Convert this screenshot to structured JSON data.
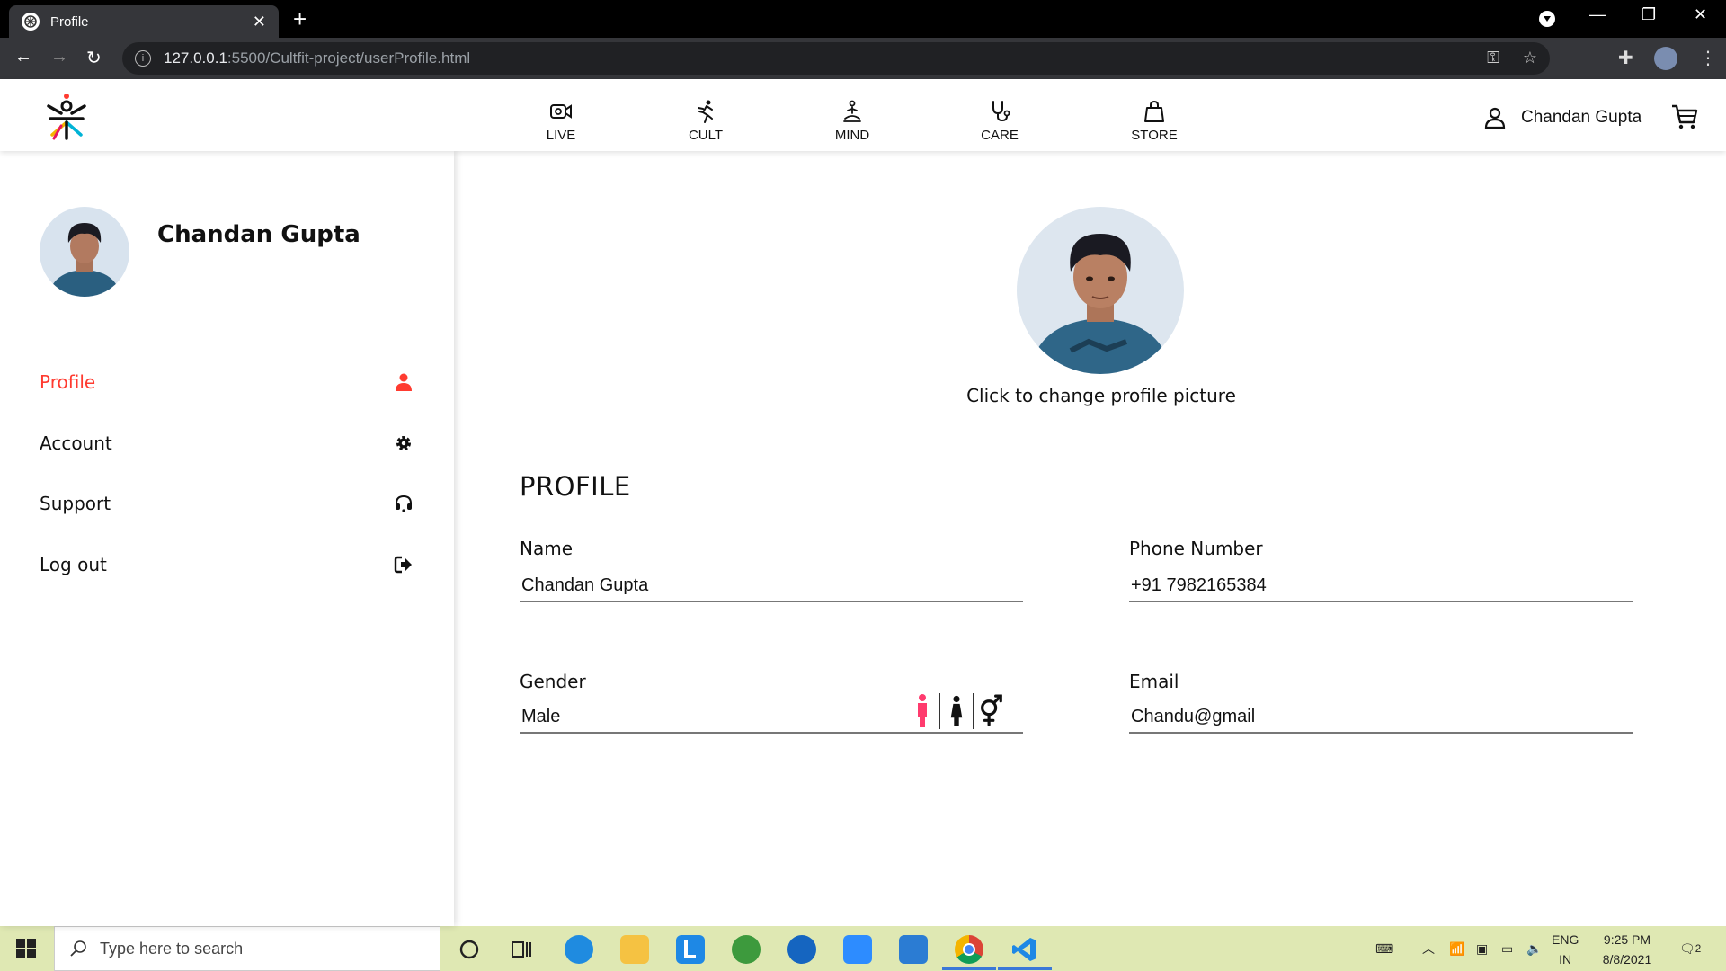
{
  "browser": {
    "tab_title": "Profile",
    "url_host": "127.0.0.1",
    "url_path": ":5500/Cultfit-project/userProfile.html"
  },
  "header": {
    "nav": [
      {
        "label": "LIVE",
        "icon": "video-camera-icon"
      },
      {
        "label": "CULT",
        "icon": "running-person-icon"
      },
      {
        "label": "MIND",
        "icon": "meditation-icon"
      },
      {
        "label": "CARE",
        "icon": "stethoscope-icon"
      },
      {
        "label": "STORE",
        "icon": "shopping-bag-icon"
      }
    ],
    "user_name": "Chandan Gupta",
    "accent": "#ff3b30"
  },
  "sidebar": {
    "name": "Chandan Gupta",
    "menu": [
      {
        "label": "Profile",
        "icon": "user-icon",
        "active": true
      },
      {
        "label": "Account",
        "icon": "gear-icon",
        "active": false
      },
      {
        "label": "Support",
        "icon": "headset-icon",
        "active": false
      },
      {
        "label": "Log out",
        "icon": "logout-icon",
        "active": false
      }
    ]
  },
  "main": {
    "change_picture": "Click to change profile picture",
    "section_title": "PROFILE",
    "fields": {
      "name": {
        "label": "Name",
        "value": "Chandan Gupta"
      },
      "phone": {
        "label": "Phone Number",
        "value": "+91 7982165384"
      },
      "gender": {
        "label": "Gender",
        "value": "Male"
      },
      "email": {
        "label": "Email",
        "value": "Chandu@gmail"
      }
    }
  },
  "taskbar": {
    "search_placeholder": "Type here to search",
    "lang_top": "ENG",
    "lang_bottom": "IN",
    "time": "9:25 PM",
    "date": "8/8/2021",
    "notifications": "2"
  }
}
